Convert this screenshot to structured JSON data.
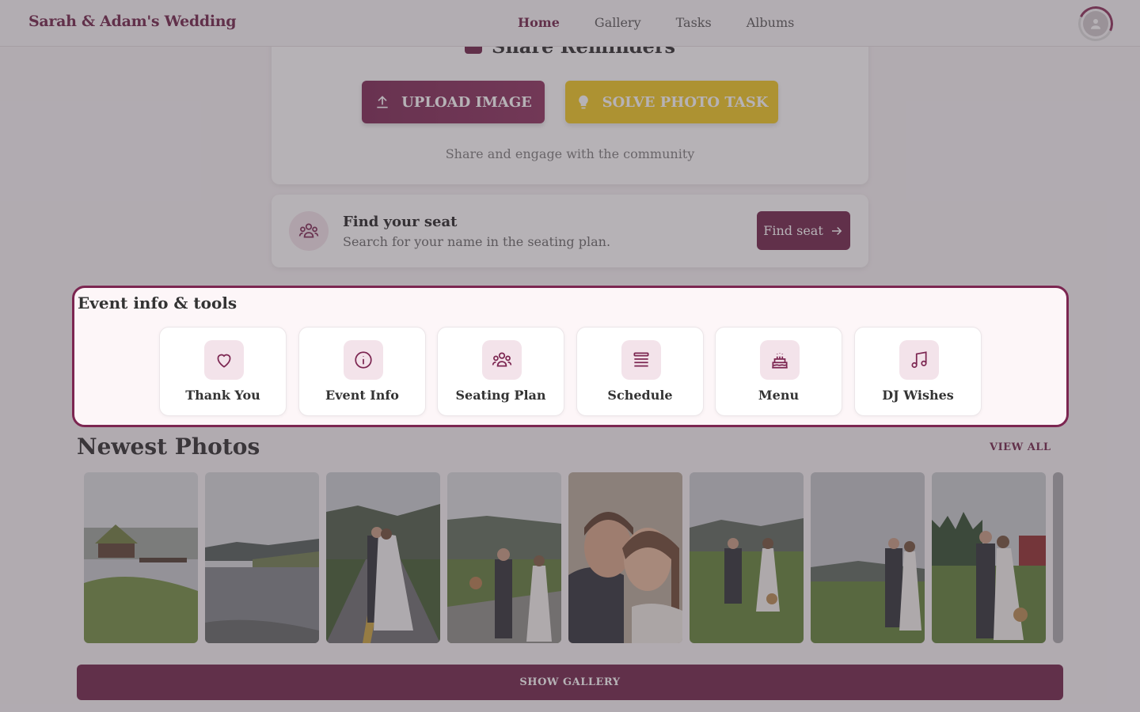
{
  "header": {
    "brand": "Sarah & Adam's Wedding",
    "nav": [
      "Home",
      "Gallery",
      "Tasks",
      "Albums"
    ],
    "active_nav": "Home"
  },
  "share_card": {
    "title": "Share Reminders",
    "upload_label": "UPLOAD IMAGE",
    "solve_label": "SOLVE PHOTO TASK",
    "subtitle": "Share and engage with the community"
  },
  "seat_card": {
    "title": "Find your seat",
    "subtitle": "Search for your name in the seating plan.",
    "button": "Find seat"
  },
  "tools": {
    "title": "Event info & tools",
    "items": [
      {
        "label": "Thank You",
        "icon": "heart-icon"
      },
      {
        "label": "Event Info",
        "icon": "info-icon"
      },
      {
        "label": "Seating Plan",
        "icon": "people-icon"
      },
      {
        "label": "Schedule",
        "icon": "list-icon"
      },
      {
        "label": "Menu",
        "icon": "cake-icon"
      },
      {
        "label": "DJ Wishes",
        "icon": "music-note-icon"
      }
    ]
  },
  "photos": {
    "title": "Newest Photos",
    "view_all": "VIEW ALL",
    "show_gallery": "SHOW GALLERY"
  },
  "colors": {
    "brand": "#6d1f46",
    "accent_gold": "#f0c81d",
    "icon_bg": "#f3e3ea"
  }
}
